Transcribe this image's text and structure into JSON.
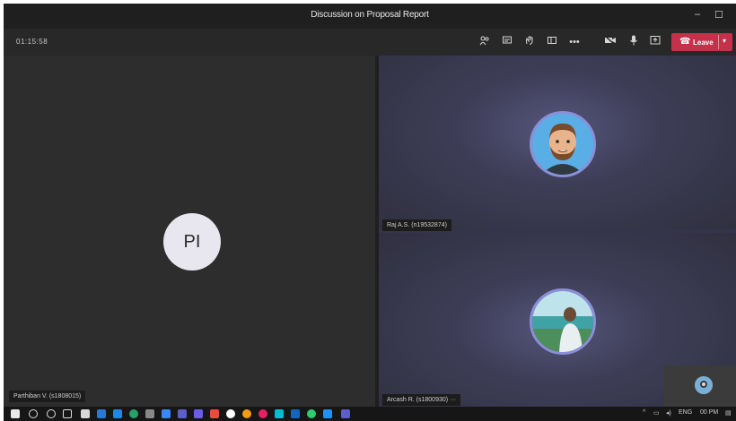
{
  "window": {
    "title": "Discussion on Proposal Report",
    "min_glyph": "–",
    "max_glyph": "☐",
    "close_glyph": "✕"
  },
  "toolbar": {
    "timer": "01:15:58",
    "leave_label": "Leave"
  },
  "participants": [
    {
      "name": "Parthiban V. (s1808015)",
      "initials": "PI",
      "avatar": "initials"
    },
    {
      "name": "Raj A.S. (n19532874)",
      "avatar": "cartoon-bearded-man"
    },
    {
      "name": "Arcash R. (s1800930) ···",
      "avatar": "photo-man-by-sea"
    }
  ],
  "taskbar": {
    "tray_lang": "ENG",
    "clock": "00 PM"
  },
  "colors": {
    "leave": "#c4314b",
    "avatar_ring": "#8a8fd8",
    "title_bar": "#201f1f"
  }
}
